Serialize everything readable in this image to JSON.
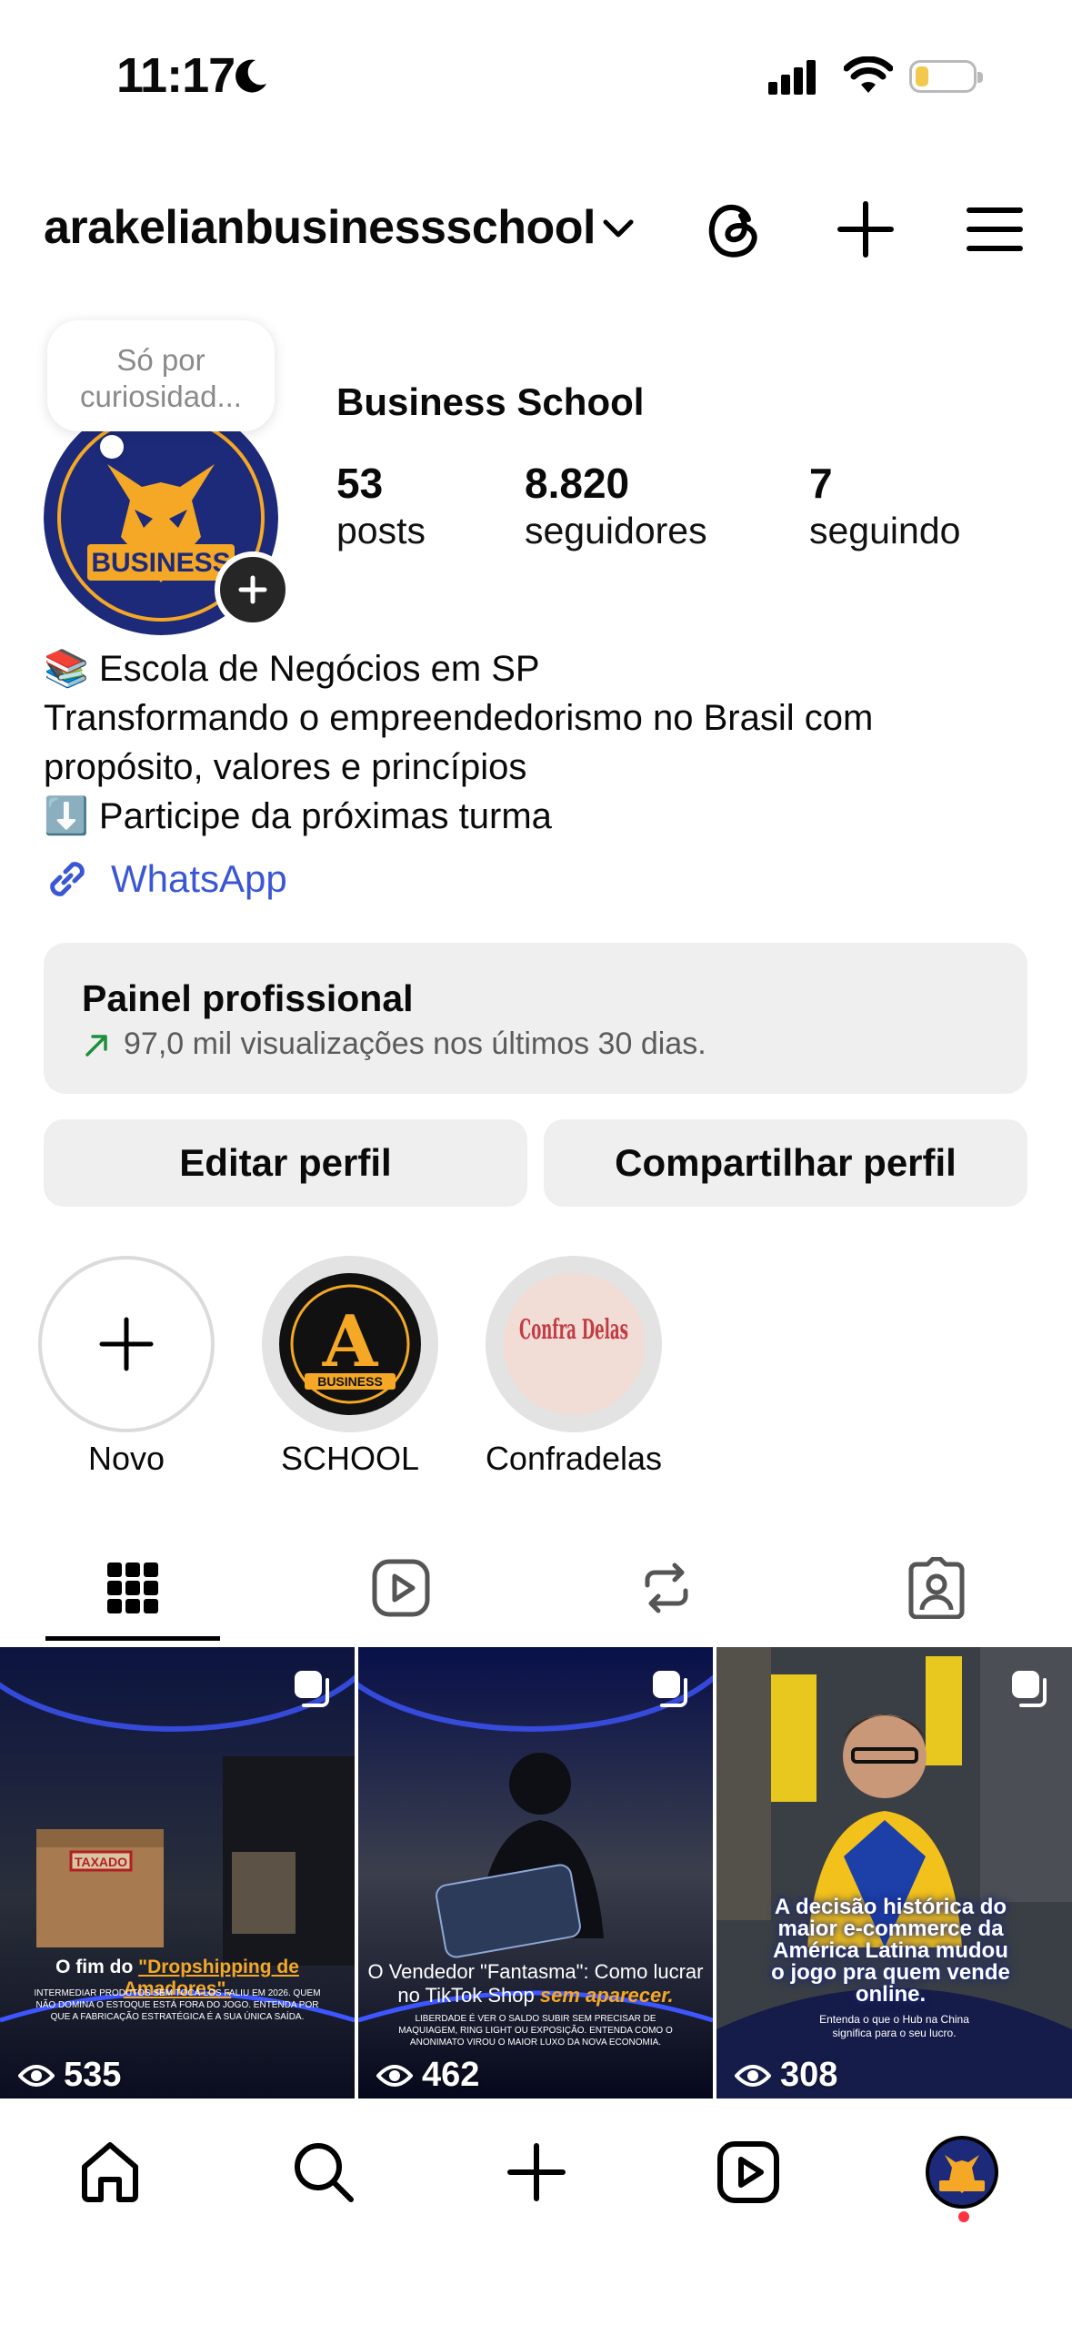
{
  "status_bar": {
    "time": "11:17"
  },
  "header": {
    "username": "arakelianbusinessschool"
  },
  "profile": {
    "note": "Só por curiosidad...",
    "display_name": "Business School",
    "avatar_text": "BUSINESS",
    "stats": [
      {
        "value": "53",
        "label": "posts"
      },
      {
        "value": "8.820",
        "label": "seguidores"
      },
      {
        "value": "7",
        "label": "seguindo"
      }
    ],
    "bio": [
      "📚 Escola de Negócios em SP",
      "Transformando o empreendedorismo no Brasil com",
      "propósito, valores e princípios",
      "⬇️ Participe da próximas turma"
    ],
    "link_label": "WhatsApp"
  },
  "pro_panel": {
    "title": "Painel profissional",
    "subtitle": "97,0 mil visualizações nos últimos 30 dias."
  },
  "buttons": {
    "edit": "Editar perfil",
    "share": "Compartilhar perfil"
  },
  "highlights": [
    {
      "label": "Novo"
    },
    {
      "label": "SCHOOL",
      "cover_text": "A",
      "cover_sub": "BUSINESS"
    },
    {
      "label": "Confradelas",
      "cover_text": "Confra Delas"
    }
  ],
  "posts": [
    {
      "views": "535",
      "stamp": "TAXADO",
      "caption_prefix": "O fim do ",
      "caption_highlight": "\"Dropshipping de Amadores\".",
      "body": "INTERMEDIAR PRODUTOS SEM TOCÁ-LOS FALIU EM 2026. QUEM NÃO DOMINA O ESTOQUE ESTÁ FORA DO JOGO. ENTENDA POR QUE A FABRICAÇÃO ESTRATÉGICA É A SUA ÚNICA SAÍDA."
    },
    {
      "views": "462",
      "caption_line1": "O Vendedor \"Fantasma\": Como lucrar",
      "caption_line2_prefix": "no TikTok Shop ",
      "caption_line2_highlight": "sem aparecer.",
      "body": "LIBERDADE É VER O SALDO SUBIR SEM PRECISAR DE MAQUIAGEM, RING LIGHT OU EXPOSIÇÃO. ENTENDA COMO O ANONIMATO VIROU O MAIOR LUXO DA NOVA ECONOMIA."
    },
    {
      "views": "308",
      "caption_lines": [
        "A decisão histórica do",
        "maior e-commerce da",
        "América Latina mudou",
        "o jogo pra quem vende",
        "online."
      ],
      "body": "Entenda o que o Hub na China significa para o seu lucro."
    }
  ],
  "colors": {
    "link": "#3b57d4",
    "panel_bg": "#efefef",
    "brand_navy": "#1d2a7a",
    "brand_gold": "#f4a825"
  }
}
